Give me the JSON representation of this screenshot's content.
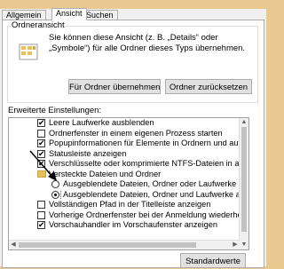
{
  "tabs": [
    "Allgemein",
    "Ansicht",
    "Suchen"
  ],
  "active_tab": 1,
  "folder_view": {
    "title": "Ordneransicht",
    "description_lines": [
      "Sie können diese Ansicht (z. B. „Details“ oder",
      "„Symbole“) für alle Ordner dieses Typs übernehmen."
    ],
    "apply_button": "Für Ordner übernehmen",
    "reset_button": "Ordner zurücksetzen"
  },
  "advanced": {
    "title": "Erweiterte Einstellungen:",
    "items": [
      {
        "type": "checkbox",
        "checked": true,
        "indent": 0,
        "label": "Leere Laufwerke ausblenden"
      },
      {
        "type": "checkbox",
        "checked": false,
        "indent": 0,
        "label": "Ordnerfenster in einem eigenen Prozess starten"
      },
      {
        "type": "checkbox",
        "checked": true,
        "indent": 0,
        "label": "Popupinformationen für Elemente in Ordnern und auf dem Desktop"
      },
      {
        "type": "checkbox",
        "checked": true,
        "indent": 0,
        "label": "Statusleiste anzeigen"
      },
      {
        "type": "checkbox",
        "checked": true,
        "indent": 0,
        "label": "Verschlüsselte oder komprimierte NTFS-Dateien in anderer Farbe"
      },
      {
        "type": "folder",
        "checked": false,
        "indent": 0,
        "label": "Versteckte Dateien und Ordner"
      },
      {
        "type": "radio",
        "checked": false,
        "indent": 1,
        "label": "Ausgeblendete Dateien, Ordner oder Laufwerke nicht anzeigen"
      },
      {
        "type": "radio",
        "checked": true,
        "indent": 1,
        "label": "Ausgeblendete Dateien, Ordner und Laufwerke anzeigen"
      },
      {
        "type": "checkbox",
        "checked": false,
        "indent": 0,
        "label": "Vollständigen Pfad in der Titelleiste anzeigen"
      },
      {
        "type": "checkbox",
        "checked": false,
        "indent": 0,
        "label": "Vorherige Ordnerfenster bei der Anmeldung wiederherstellen"
      },
      {
        "type": "checkbox",
        "checked": true,
        "indent": 0,
        "label": "Vorschauhandler im Vorschaufenster anzeigen"
      }
    ],
    "selected_index": 7
  },
  "defaults_button": "Standardwerte",
  "colors": {
    "highlight_bg": "#e9c98f",
    "folder": "#e8c15b",
    "button_bg": "#e1e1e1"
  }
}
